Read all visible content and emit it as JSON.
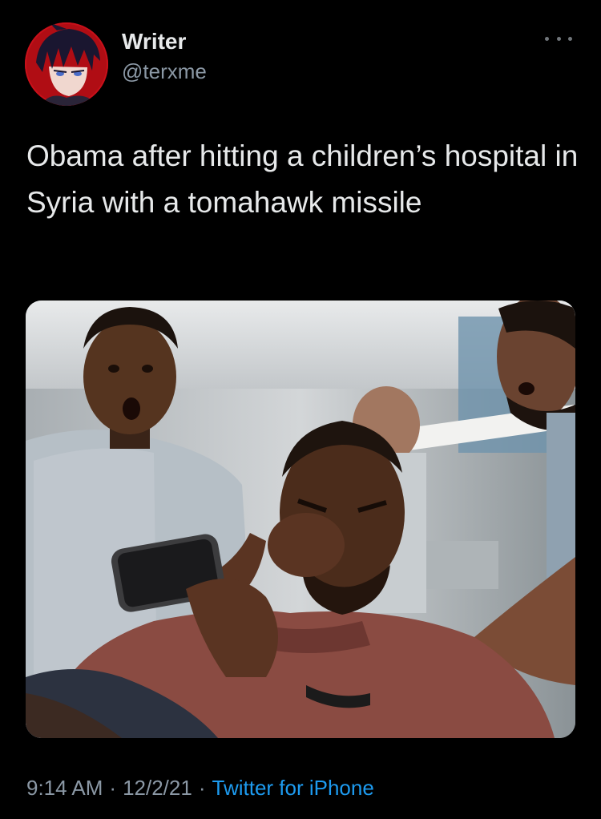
{
  "author": {
    "display_name": "Writer",
    "handle": "@terxme",
    "avatar_icon": "anime-avatar-icon"
  },
  "tweet": {
    "text": "Obama after hitting a children’s hospital in Syria with a tomahawk missile",
    "media_icon": "photo-barbershop-reaction",
    "more_icon": "more-options-icon"
  },
  "meta": {
    "time": "9:14 AM",
    "separator": "·",
    "date": "12/2/21",
    "source": "Twitter for iPhone"
  },
  "colors": {
    "background": "#000000",
    "primary_text": "#e7e9ea",
    "secondary_text": "#8b98a5",
    "link": "#1d9bf0"
  }
}
